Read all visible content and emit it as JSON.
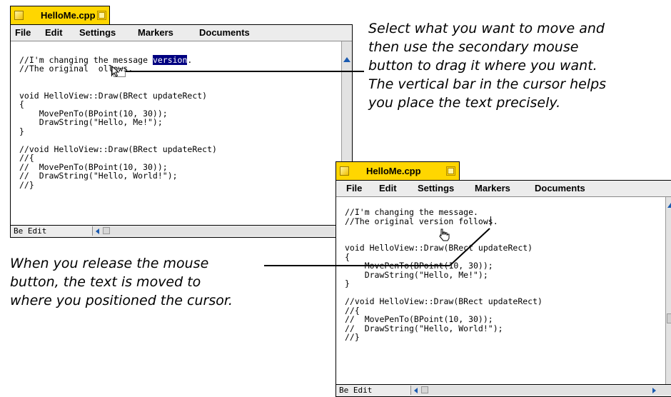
{
  "windows": {
    "before": {
      "title": "HelloMe.cpp",
      "menu": [
        "File",
        "Edit",
        "Settings",
        "Markers",
        "Documents"
      ],
      "code_lines": [
        "//The original  ollows.",
        "",
        "",
        "void HelloView::Draw(BRect updateRect)",
        "{",
        "    MovePenTo(BPoint(10, 30));",
        "    DrawString(\"Hello, Me!\");",
        "}",
        "",
        "//void HelloView::Draw(BRect updateRect)",
        "//{",
        "//  MovePenTo(BPoint(10, 30));",
        "//  DrawString(\"Hello, World!\");",
        "//}"
      ],
      "first_line_before": "//I'm changing the message ",
      "selected_text": "version",
      "first_line_after": ".",
      "status": "Be Edit"
    },
    "after": {
      "title": "HelloMe.cpp",
      "menu": [
        "File",
        "Edit",
        "Settings",
        "Markers",
        "Documents"
      ],
      "code_lines": [
        "//I'm changing the message.",
        "//The original version follows.",
        "",
        "",
        "void HelloView::Draw(BRect updateRect)",
        "{",
        "    MovePenTo(BPoint(10, 30));",
        "    DrawString(\"Hello, Me!\");",
        "}",
        "",
        "//void HelloView::Draw(BRect updateRect)",
        "//{",
        "//  MovePenTo(BPoint(10, 30));",
        "//  DrawString(\"Hello, World!\");",
        "//}"
      ],
      "status": "Be Edit"
    }
  },
  "captions": {
    "drag": [
      "Select what you want to move and",
      "then use the secondary mouse",
      "button to drag it where you want.",
      "The vertical bar in the cursor helps",
      "you place the text precisely."
    ],
    "release": [
      "When you release the mouse",
      "button, the text is moved to",
      "where you positioned the cursor."
    ]
  },
  "icons": {
    "close": "close-box-icon",
    "zoom": "zoom-box-icon",
    "drag_cursor": "drag-arrow-cursor-icon",
    "hand_cursor": "hand-cursor-icon"
  },
  "colors": {
    "title_tab": "#ffd600",
    "selection": "#000080",
    "scroll_arrow": "#1a5ab0"
  }
}
